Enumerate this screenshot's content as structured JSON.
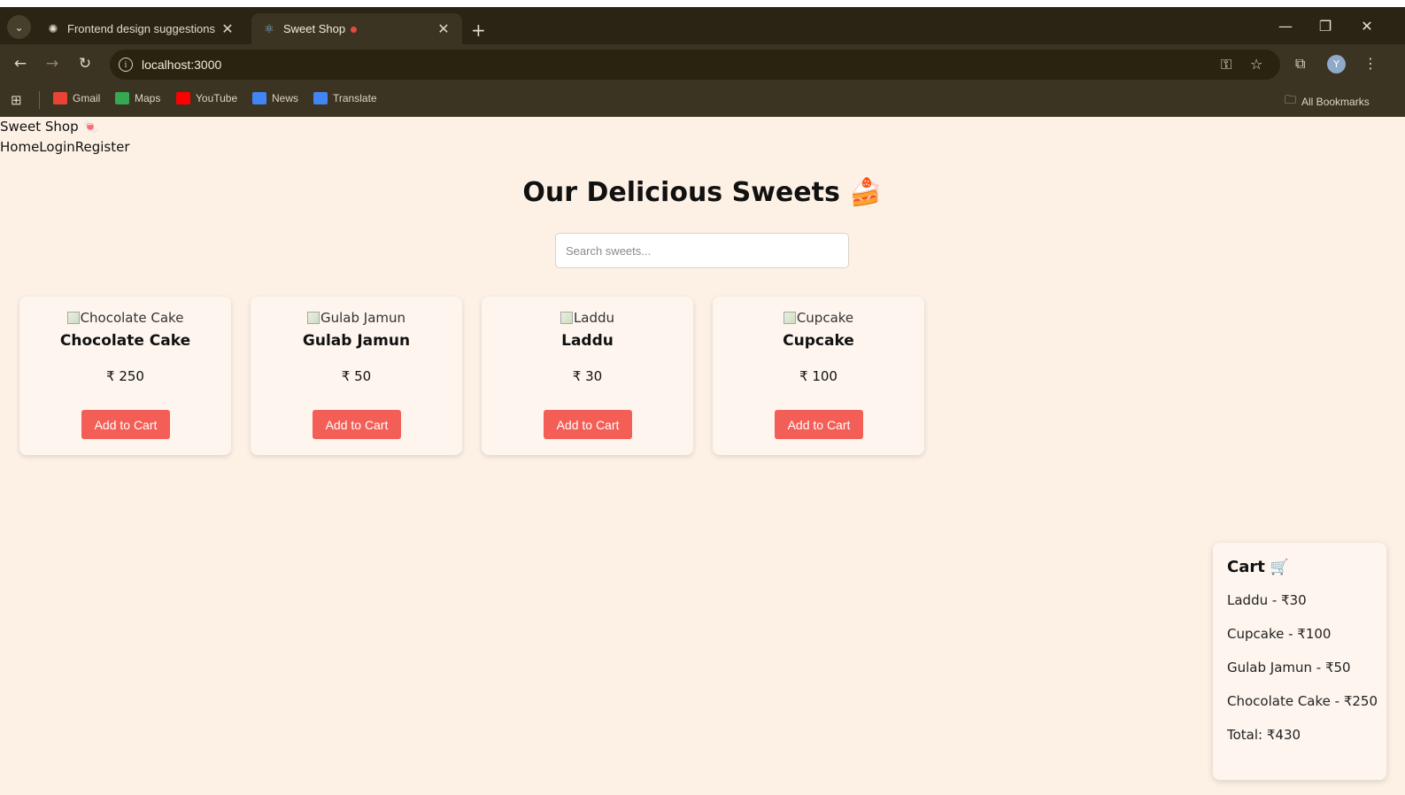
{
  "browser": {
    "tabs": [
      {
        "title": "Frontend design suggestions",
        "icon": "openai-icon"
      },
      {
        "title": "Sweet Shop",
        "icon": "react-icon",
        "recording": true
      }
    ],
    "url": "localhost:3000",
    "profile_initial": "Y",
    "bookmarks": [
      {
        "label": "Gmail",
        "icon": "gmail-icon",
        "color": "#ea4335"
      },
      {
        "label": "Maps",
        "icon": "maps-icon",
        "color": "#34a853"
      },
      {
        "label": "YouTube",
        "icon": "youtube-icon",
        "color": "#ff0000"
      },
      {
        "label": "News",
        "icon": "news-icon",
        "color": "#4285f4"
      },
      {
        "label": "Translate",
        "icon": "translate-icon",
        "color": "#4285f4"
      }
    ],
    "all_bookmarks": "All Bookmarks"
  },
  "site": {
    "brand": "Sweet Shop 🍬",
    "nav": [
      "Home",
      "Login",
      "Register"
    ]
  },
  "main": {
    "heading": "Our Delicious Sweets 🍰",
    "search_placeholder": "Search sweets...",
    "products": [
      {
        "alt": "Chocolate Cake",
        "name": "Chocolate Cake",
        "price": "₹ 250",
        "button": "Add to Cart"
      },
      {
        "alt": "Gulab Jamun",
        "name": "Gulab Jamun",
        "price": "₹ 50",
        "button": "Add to Cart"
      },
      {
        "alt": "Laddu",
        "name": "Laddu",
        "price": "₹ 30",
        "button": "Add to Cart"
      },
      {
        "alt": "Cupcake",
        "name": "Cupcake",
        "price": "₹ 100",
        "button": "Add to Cart"
      }
    ]
  },
  "cart": {
    "title": "Cart",
    "icon": "shopping-cart-icon",
    "items": [
      "Laddu - ₹30",
      "Cupcake - ₹100",
      "Gulab Jamun - ₹50",
      "Chocolate Cake - ₹250"
    ],
    "total": "Total: ₹430"
  },
  "colors": {
    "page_bg": "#fdf1e5",
    "card_bg": "#fdf5ee",
    "button_bg": "#f35f57",
    "chrome_dark": "#2a2415",
    "chrome_toolbar": "#3b3422"
  }
}
